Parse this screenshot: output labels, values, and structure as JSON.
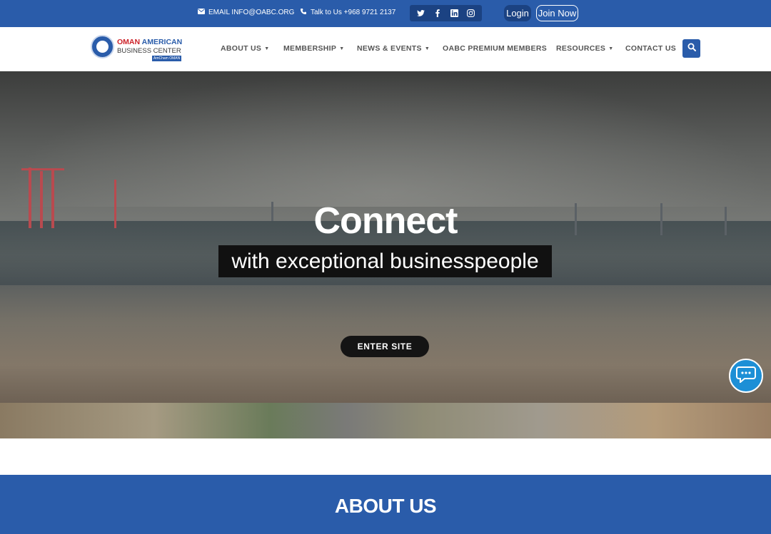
{
  "topbar": {
    "email_label": "EMAIL INFO@OABC.ORG",
    "phone_label": "Talk to Us +968 9721 2137",
    "social": [
      "twitter-icon",
      "facebook-icon",
      "linkedin-icon",
      "instagram-icon"
    ],
    "login_label": "Login",
    "join_label": "Join Now"
  },
  "logo": {
    "line1_a": "OMAN",
    "line1_b": "AMERICAN",
    "line2": "BUSINESS CENTER",
    "line3": "AmCham OMAN"
  },
  "nav": {
    "items": [
      {
        "label": "ABOUT US",
        "dropdown": true
      },
      {
        "label": "MEMBERSHIP",
        "dropdown": true
      },
      {
        "label": "NEWS & EVENTS",
        "dropdown": true
      },
      {
        "label": "OABC PREMIUM MEMBERS",
        "dropdown": false
      },
      {
        "label": "RESOURCES",
        "dropdown": true
      },
      {
        "label": "CONTACT US",
        "dropdown": false
      }
    ]
  },
  "hero": {
    "title": "Connect",
    "subtitle": "with exceptional businesspeople",
    "cta_label": "ENTER SITE"
  },
  "about": {
    "heading": "ABOUT US"
  },
  "colors": {
    "brand_blue": "#2a5caa",
    "dark_blue": "#1b4282",
    "logo_red": "#cc2229",
    "chat_blue": "#1d8fd6"
  }
}
